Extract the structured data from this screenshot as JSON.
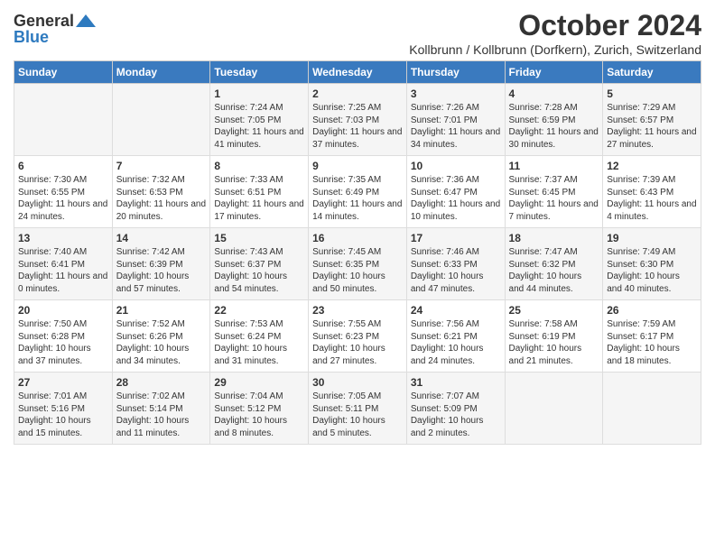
{
  "logo": {
    "general": "General",
    "blue": "Blue"
  },
  "title": "October 2024",
  "subtitle": "Kollbrunn / Kollbrunn (Dorfkern), Zurich, Switzerland",
  "weekdays": [
    "Sunday",
    "Monday",
    "Tuesday",
    "Wednesday",
    "Thursday",
    "Friday",
    "Saturday"
  ],
  "weeks": [
    [
      {
        "day": "",
        "info": ""
      },
      {
        "day": "",
        "info": ""
      },
      {
        "day": "1",
        "info": "Sunrise: 7:24 AM\nSunset: 7:05 PM\nDaylight: 11 hours and 41 minutes."
      },
      {
        "day": "2",
        "info": "Sunrise: 7:25 AM\nSunset: 7:03 PM\nDaylight: 11 hours and 37 minutes."
      },
      {
        "day": "3",
        "info": "Sunrise: 7:26 AM\nSunset: 7:01 PM\nDaylight: 11 hours and 34 minutes."
      },
      {
        "day": "4",
        "info": "Sunrise: 7:28 AM\nSunset: 6:59 PM\nDaylight: 11 hours and 30 minutes."
      },
      {
        "day": "5",
        "info": "Sunrise: 7:29 AM\nSunset: 6:57 PM\nDaylight: 11 hours and 27 minutes."
      }
    ],
    [
      {
        "day": "6",
        "info": "Sunrise: 7:30 AM\nSunset: 6:55 PM\nDaylight: 11 hours and 24 minutes."
      },
      {
        "day": "7",
        "info": "Sunrise: 7:32 AM\nSunset: 6:53 PM\nDaylight: 11 hours and 20 minutes."
      },
      {
        "day": "8",
        "info": "Sunrise: 7:33 AM\nSunset: 6:51 PM\nDaylight: 11 hours and 17 minutes."
      },
      {
        "day": "9",
        "info": "Sunrise: 7:35 AM\nSunset: 6:49 PM\nDaylight: 11 hours and 14 minutes."
      },
      {
        "day": "10",
        "info": "Sunrise: 7:36 AM\nSunset: 6:47 PM\nDaylight: 11 hours and 10 minutes."
      },
      {
        "day": "11",
        "info": "Sunrise: 7:37 AM\nSunset: 6:45 PM\nDaylight: 11 hours and 7 minutes."
      },
      {
        "day": "12",
        "info": "Sunrise: 7:39 AM\nSunset: 6:43 PM\nDaylight: 11 hours and 4 minutes."
      }
    ],
    [
      {
        "day": "13",
        "info": "Sunrise: 7:40 AM\nSunset: 6:41 PM\nDaylight: 11 hours and 0 minutes."
      },
      {
        "day": "14",
        "info": "Sunrise: 7:42 AM\nSunset: 6:39 PM\nDaylight: 10 hours and 57 minutes."
      },
      {
        "day": "15",
        "info": "Sunrise: 7:43 AM\nSunset: 6:37 PM\nDaylight: 10 hours and 54 minutes."
      },
      {
        "day": "16",
        "info": "Sunrise: 7:45 AM\nSunset: 6:35 PM\nDaylight: 10 hours and 50 minutes."
      },
      {
        "day": "17",
        "info": "Sunrise: 7:46 AM\nSunset: 6:33 PM\nDaylight: 10 hours and 47 minutes."
      },
      {
        "day": "18",
        "info": "Sunrise: 7:47 AM\nSunset: 6:32 PM\nDaylight: 10 hours and 44 minutes."
      },
      {
        "day": "19",
        "info": "Sunrise: 7:49 AM\nSunset: 6:30 PM\nDaylight: 10 hours and 40 minutes."
      }
    ],
    [
      {
        "day": "20",
        "info": "Sunrise: 7:50 AM\nSunset: 6:28 PM\nDaylight: 10 hours and 37 minutes."
      },
      {
        "day": "21",
        "info": "Sunrise: 7:52 AM\nSunset: 6:26 PM\nDaylight: 10 hours and 34 minutes."
      },
      {
        "day": "22",
        "info": "Sunrise: 7:53 AM\nSunset: 6:24 PM\nDaylight: 10 hours and 31 minutes."
      },
      {
        "day": "23",
        "info": "Sunrise: 7:55 AM\nSunset: 6:23 PM\nDaylight: 10 hours and 27 minutes."
      },
      {
        "day": "24",
        "info": "Sunrise: 7:56 AM\nSunset: 6:21 PM\nDaylight: 10 hours and 24 minutes."
      },
      {
        "day": "25",
        "info": "Sunrise: 7:58 AM\nSunset: 6:19 PM\nDaylight: 10 hours and 21 minutes."
      },
      {
        "day": "26",
        "info": "Sunrise: 7:59 AM\nSunset: 6:17 PM\nDaylight: 10 hours and 18 minutes."
      }
    ],
    [
      {
        "day": "27",
        "info": "Sunrise: 7:01 AM\nSunset: 5:16 PM\nDaylight: 10 hours and 15 minutes."
      },
      {
        "day": "28",
        "info": "Sunrise: 7:02 AM\nSunset: 5:14 PM\nDaylight: 10 hours and 11 minutes."
      },
      {
        "day": "29",
        "info": "Sunrise: 7:04 AM\nSunset: 5:12 PM\nDaylight: 10 hours and 8 minutes."
      },
      {
        "day": "30",
        "info": "Sunrise: 7:05 AM\nSunset: 5:11 PM\nDaylight: 10 hours and 5 minutes."
      },
      {
        "day": "31",
        "info": "Sunrise: 7:07 AM\nSunset: 5:09 PM\nDaylight: 10 hours and 2 minutes."
      },
      {
        "day": "",
        "info": ""
      },
      {
        "day": "",
        "info": ""
      }
    ]
  ]
}
